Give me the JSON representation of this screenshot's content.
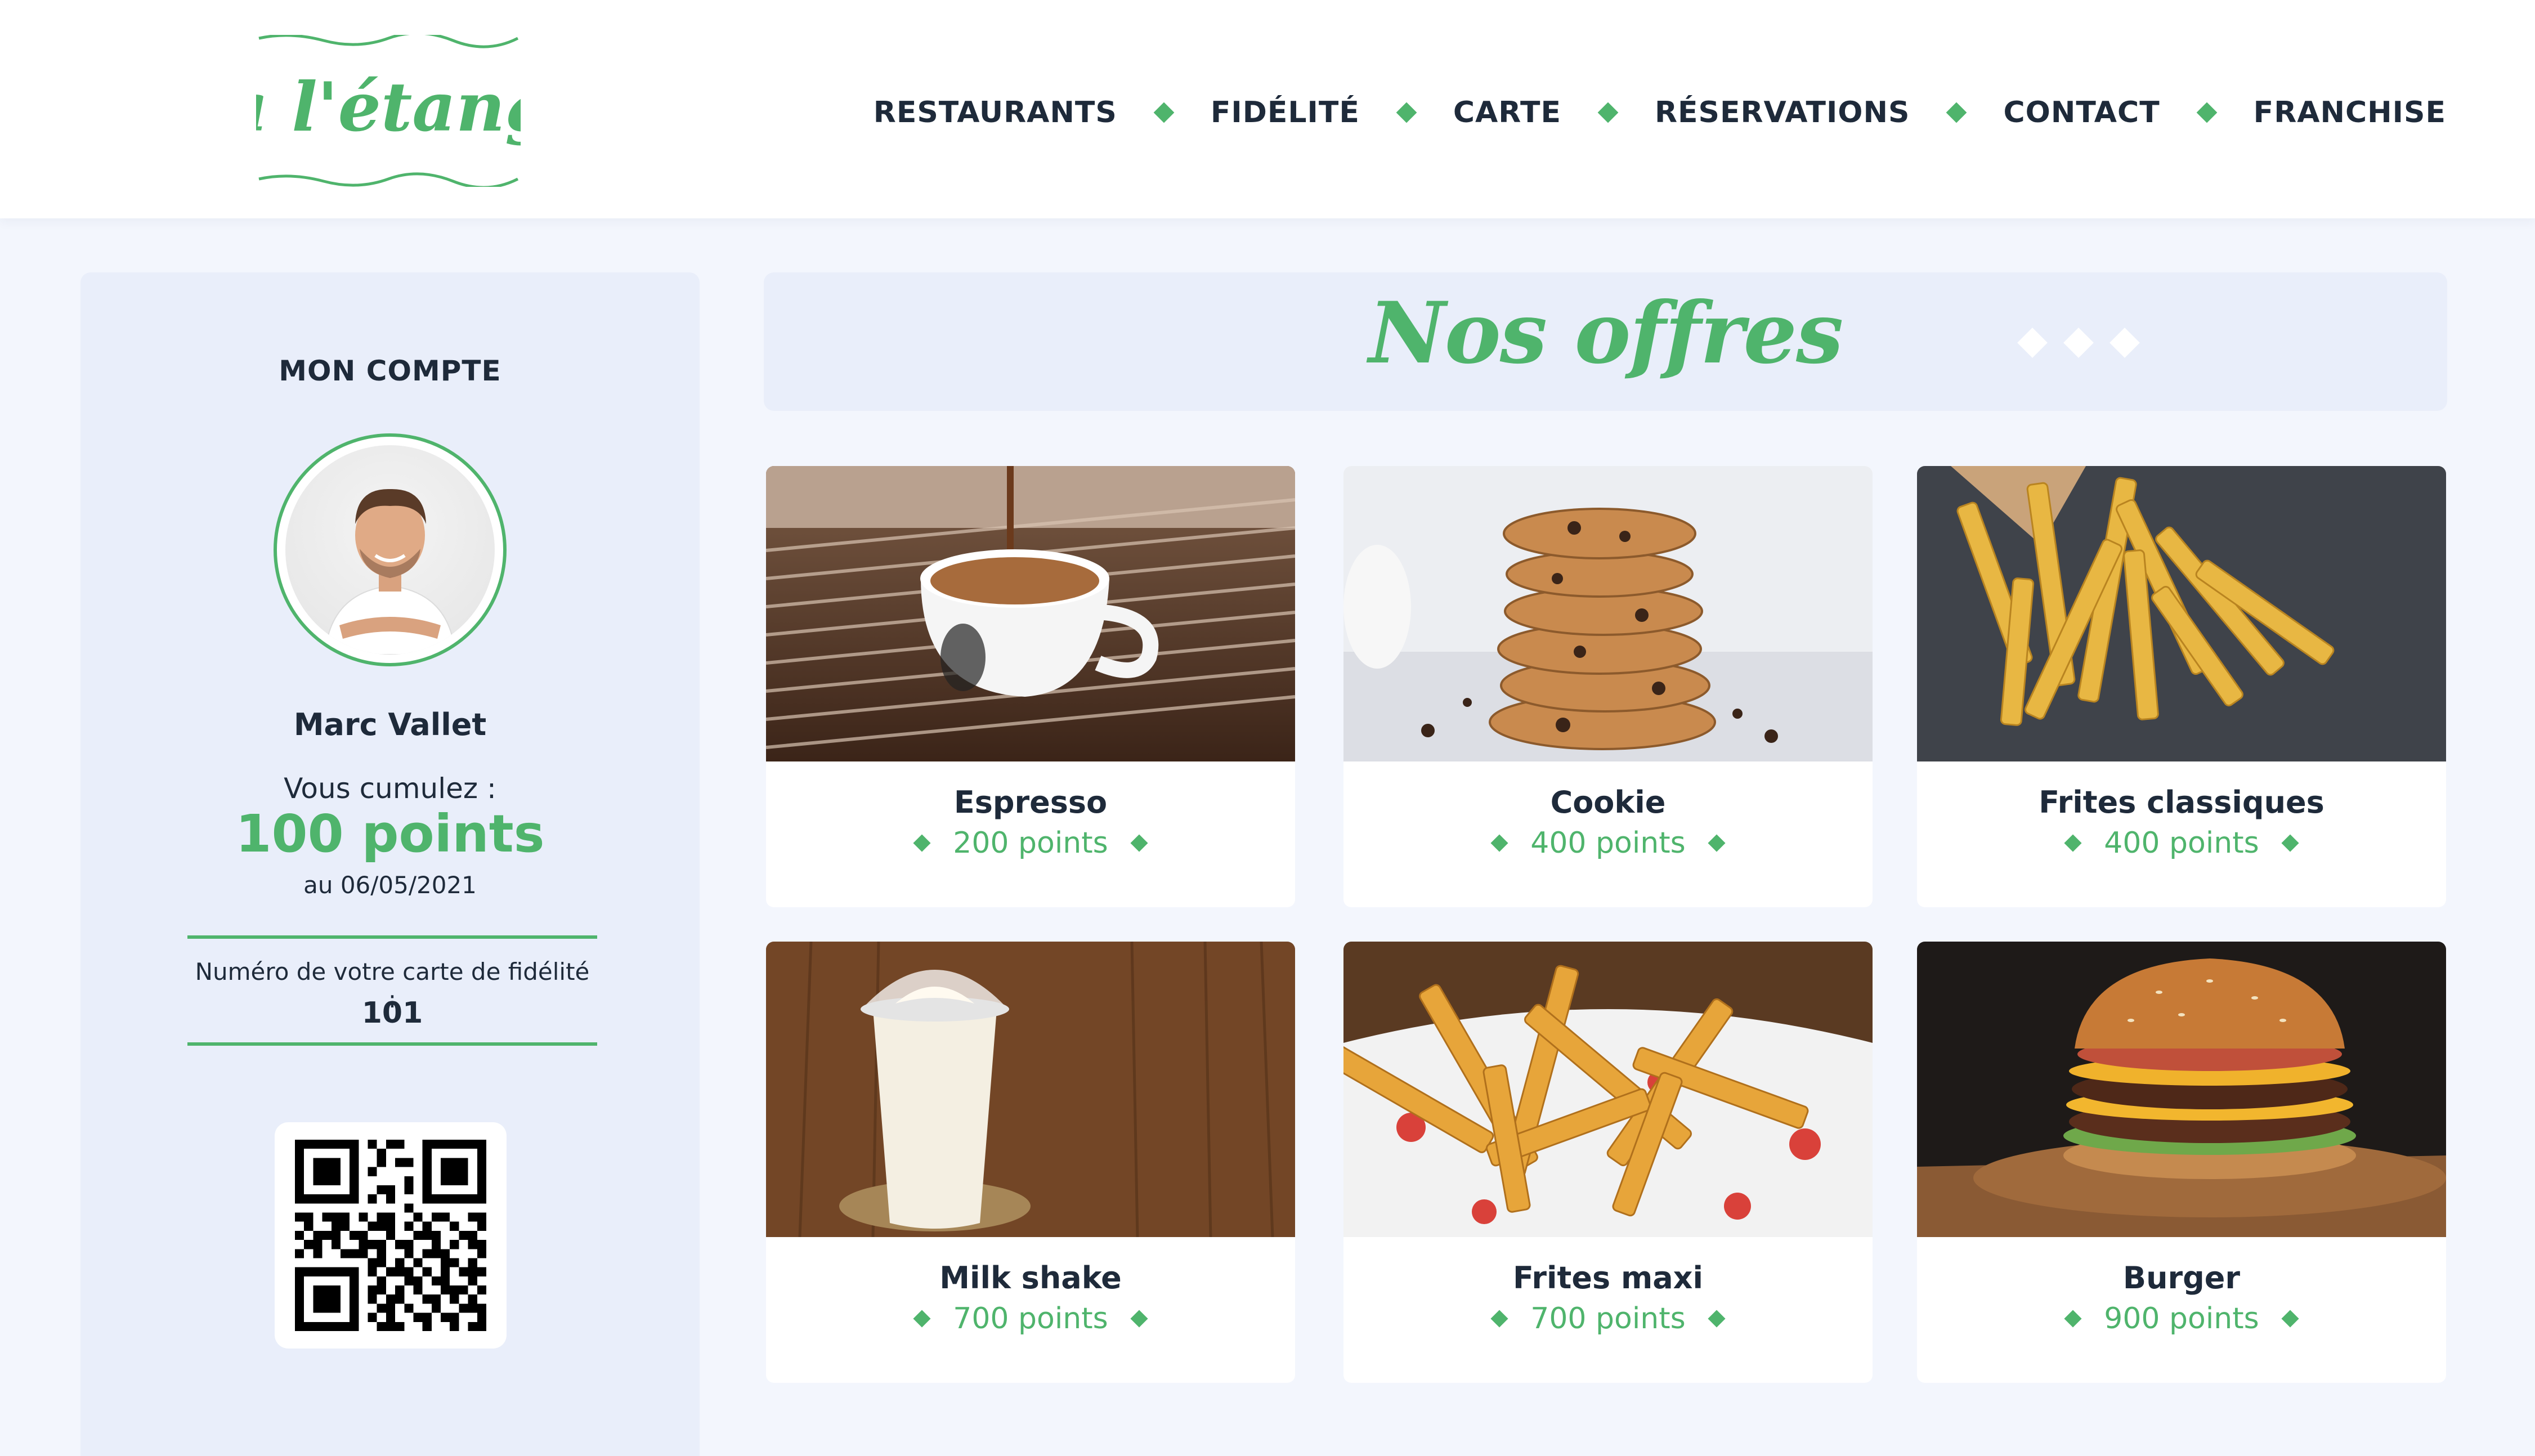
{
  "brand": {
    "name": "à l'étang",
    "color": "#4fb46c"
  },
  "nav": {
    "items": [
      {
        "label": "RESTAURANTS"
      },
      {
        "label": "FIDÉLITÉ"
      },
      {
        "label": "CARTE"
      },
      {
        "label": "RÉSERVATIONS"
      },
      {
        "label": "CONTACT"
      },
      {
        "label": "FRANCHISE"
      }
    ]
  },
  "account": {
    "title": "MON COMPTE",
    "name": "Marc Vallet",
    "cumul_label": "Vous cumulez :",
    "points": "100 points",
    "date": "au 06/05/2021",
    "card_label": "Numéro de votre carte de fidélité :",
    "card_number": "101"
  },
  "offers": {
    "title": "Nos offres",
    "items": [
      {
        "name": "Espresso",
        "points": "200 points",
        "icon": "espresso-image"
      },
      {
        "name": "Cookie",
        "points": "400 points",
        "icon": "cookie-image"
      },
      {
        "name": "Frites classiques",
        "points": "400 points",
        "icon": "fries-image"
      },
      {
        "name": "Milk shake",
        "points": "700 points",
        "icon": "milkshake-image"
      },
      {
        "name": "Frites maxi",
        "points": "700 points",
        "icon": "fries-basket-image"
      },
      {
        "name": "Burger",
        "points": "900 points",
        "icon": "burger-image"
      }
    ]
  }
}
